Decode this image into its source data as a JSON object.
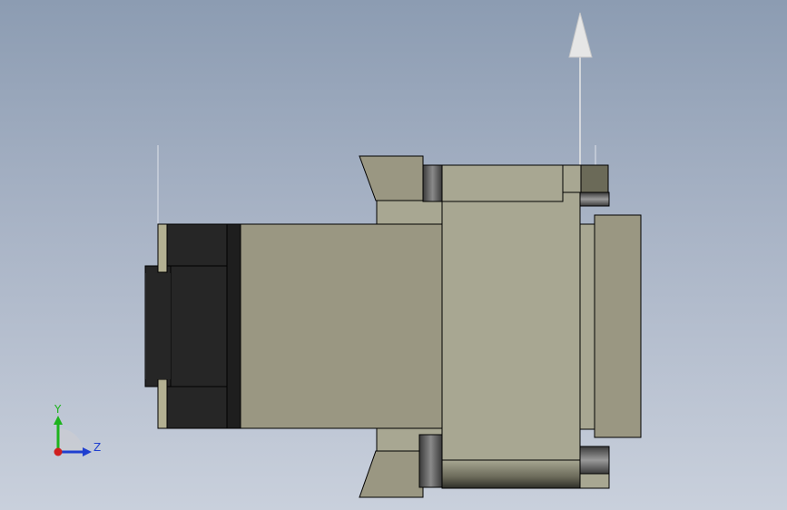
{
  "viewport": {
    "background_top": "#8c9cb2",
    "background_bottom": "#c9d0dc"
  },
  "model": {
    "body_color": "#9a9782",
    "flange_color": "#a8a792",
    "dark_cap_color": "#262626",
    "roller_color": "#5a5a5a",
    "outline_color": "#000000"
  },
  "triad": {
    "y_label": "Y",
    "z_label": "Z",
    "y_color": "#1db31d",
    "z_color": "#1f3fd0",
    "origin_color": "#d01f1f"
  },
  "direction_arrow": {
    "icon": "up-arrow-icon",
    "color": "#e6e6e6"
  }
}
